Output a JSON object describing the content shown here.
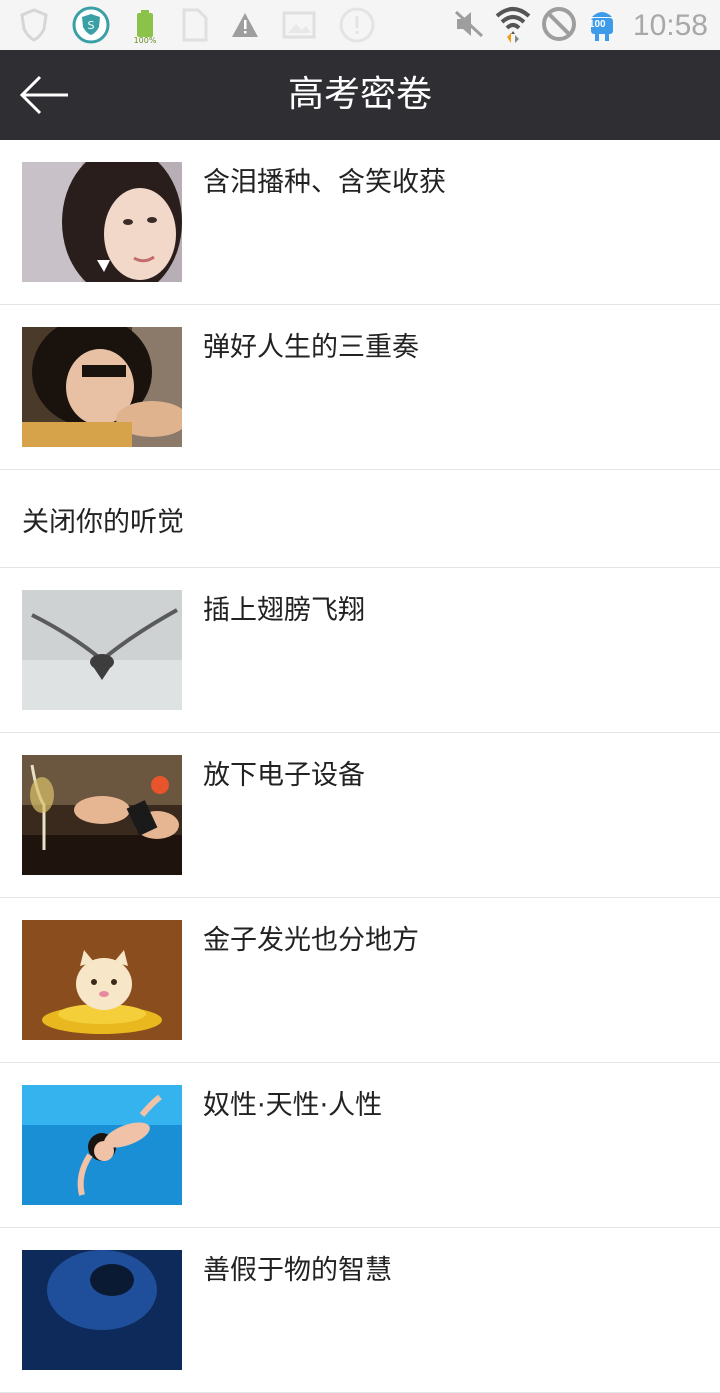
{
  "status_bar": {
    "time": "10:58",
    "battery_label": "100%",
    "android_badge": "100"
  },
  "app_bar": {
    "title": "高考密卷"
  },
  "list": {
    "items": [
      {
        "label": "含泪播种、含笑收获",
        "has_thumbnail": true,
        "thumbnail": "woman-portrait"
      },
      {
        "label": "弹好人生的三重奏",
        "has_thumbnail": true,
        "thumbnail": "girl-portrait"
      },
      {
        "label": "关闭你的听觉",
        "has_thumbnail": false
      },
      {
        "label": "插上翅膀飞翔",
        "has_thumbnail": true,
        "thumbnail": "bird-flying"
      },
      {
        "label": "放下电子设备",
        "has_thumbnail": true,
        "thumbnail": "phones-table"
      },
      {
        "label": "金子发光也分地方",
        "has_thumbnail": true,
        "thumbnail": "cartoon-cat"
      },
      {
        "label": "奴性·天性·人性",
        "has_thumbnail": true,
        "thumbnail": "baby-swimming"
      },
      {
        "label": "善假于物的智慧",
        "has_thumbnail": true,
        "thumbnail": "blue-image"
      }
    ]
  }
}
